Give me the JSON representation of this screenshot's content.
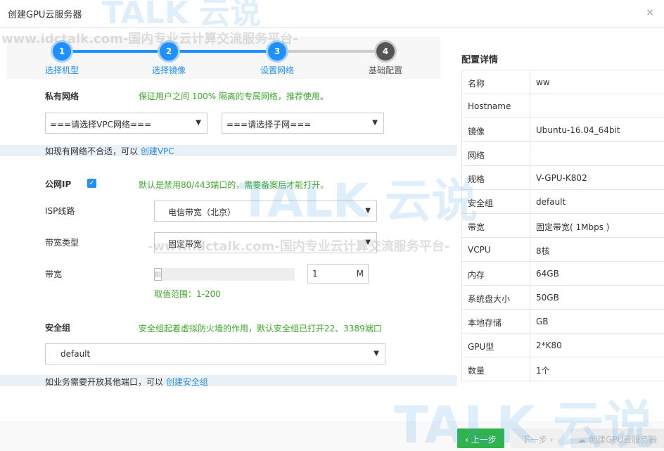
{
  "window": {
    "title": "创建GPU云服务器"
  },
  "steps": [
    {
      "num": "1",
      "label": "选择机型",
      "state": "active"
    },
    {
      "num": "2",
      "label": "选择镜像",
      "state": "active"
    },
    {
      "num": "3",
      "label": "设置网络",
      "state": "active"
    },
    {
      "num": "4",
      "label": "基础配置",
      "state": "inactive"
    }
  ],
  "network": {
    "label": "私有网络",
    "hint": "保证用户之间 100% 隔离的专属网络，推荐使用。",
    "vpc_select": "===请选择VPC网络===",
    "subnet_select": "===请选择子网===",
    "note_text": "如现有网络不合适，可以",
    "note_link": "创建VPC"
  },
  "public_ip": {
    "label": "公网IP",
    "checked": true,
    "hint": "默认是禁用80/443端口的，需要备案后才能打开。",
    "isp_label": "ISP线路",
    "isp_value": "电信带宽（北京）",
    "bw_type_label": "带宽类型",
    "bw_type_value": "固定带宽",
    "bw_label": "带宽",
    "bw_value": "1",
    "bw_unit": "M",
    "bw_range": "取值范围：1-200"
  },
  "security": {
    "label": "安全组",
    "hint": "安全组起着虚拟防火墙的作用，默认安全组已打开22、3389端口",
    "select": "default",
    "note_text": "如业务需要开放其他端口，可以",
    "note_link": "创建安全组"
  },
  "details": {
    "title": "配置详情",
    "rows": [
      {
        "k": "名称",
        "v": "ww"
      },
      {
        "k": "Hostname",
        "v": ""
      },
      {
        "k": "镜像",
        "v": "Ubuntu-16.04_64bit"
      },
      {
        "k": "网络",
        "v": ""
      },
      {
        "k": "规格",
        "v": "V-GPU-K802"
      },
      {
        "k": "安全组",
        "v": "default"
      },
      {
        "k": "带宽",
        "v": "固定带宽( 1Mbps )"
      },
      {
        "k": "VCPU",
        "v": "8核"
      },
      {
        "k": "内存",
        "v": "64GB"
      },
      {
        "k": "系统盘大小",
        "v": "50GB"
      },
      {
        "k": "本地存储",
        "v": "GB"
      },
      {
        "k": "GPU型",
        "v": "2*K80"
      },
      {
        "k": "数量",
        "v": "1个"
      }
    ]
  },
  "footer": {
    "prev_label": "‹ 上一步",
    "next_label": "下一步 ›",
    "create_label": "创建GPU云服务器"
  },
  "watermark": {
    "brand": "TALK 云说",
    "url": "www.idctalk.com-国内专业云计算交流服务平台-",
    "url_mid": "-www.idctalk.com-国内专业云计算交流服务平台-"
  },
  "colors": {
    "accent": "#1e90ff",
    "green": "#3fa92c",
    "primary_button": "#2fb34a"
  }
}
